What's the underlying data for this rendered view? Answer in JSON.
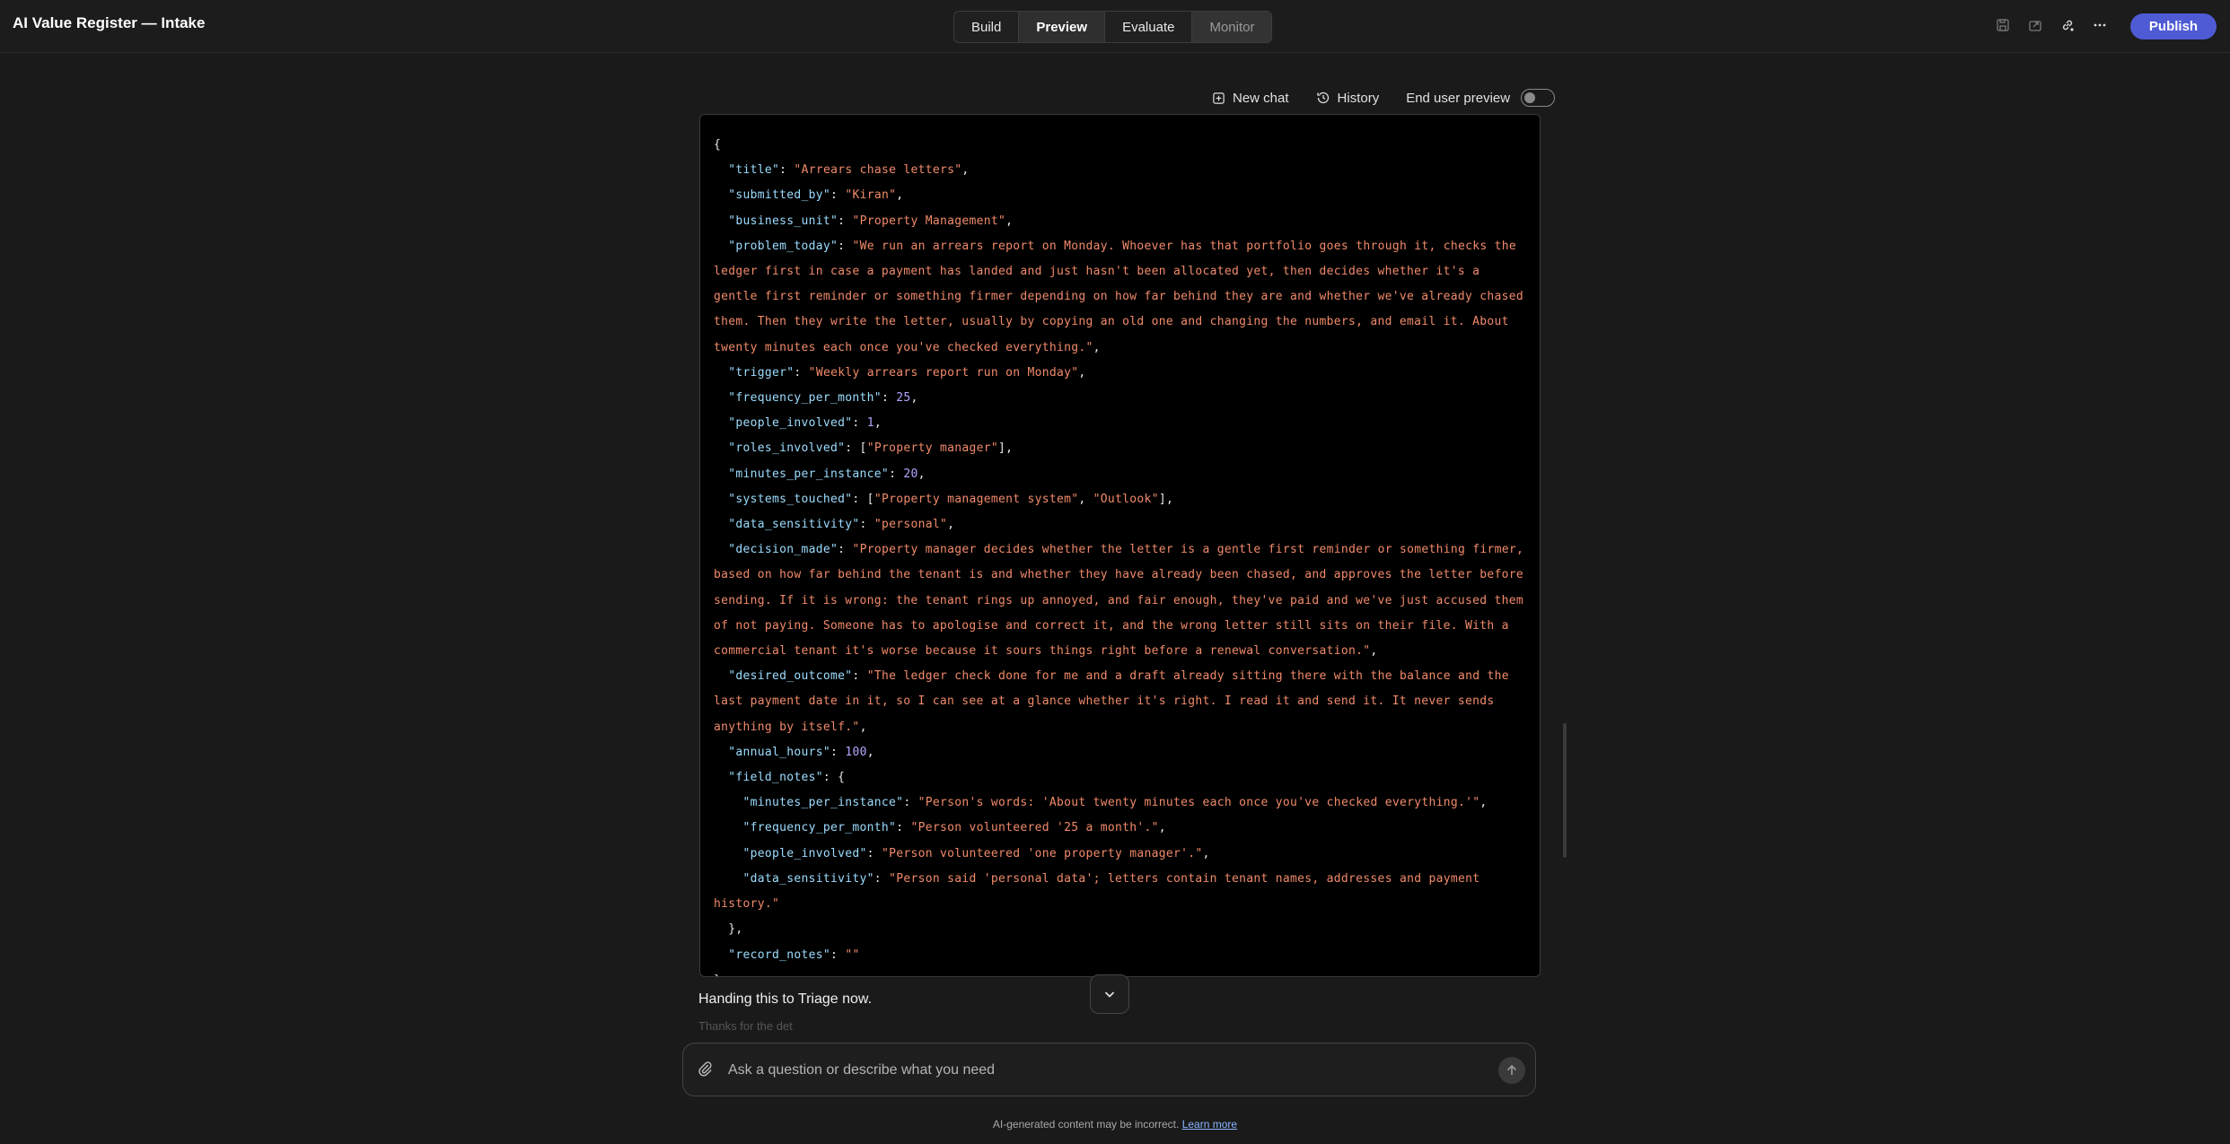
{
  "app": {
    "title": "AI Value Register — Intake"
  },
  "tabs": [
    "Build",
    "Preview",
    "Evaluate",
    "Monitor"
  ],
  "topbar": {
    "icons": [
      "save-icon",
      "share-icon",
      "link-icon",
      "more-icon"
    ],
    "publish_label": "Publish",
    "accent_color": "#4f5bd5"
  },
  "chat_toolbar": {
    "new_chat": "New chat",
    "history": "History",
    "end_user_preview": "End user preview",
    "end_user_preview_on": false
  },
  "record": {
    "title": "Arrears chase letters",
    "submitted_by": "Kiran",
    "business_unit": "Property Management",
    "problem_today": "We run an arrears report on Monday. Whoever has that portfolio goes through it, checks the ledger first in case a payment has landed and just hasn't been allocated yet, then decides whether it's a gentle first reminder or something firmer depending on how far behind they are and whether we've already chased them. Then they write the letter, usually by copying an old one and changing the numbers, and email it. About twenty minutes each once you've checked everything.",
    "trigger": "Weekly arrears report run on Monday",
    "frequency_per_month": 25,
    "people_involved": 1,
    "roles_involved": [
      "Property manager"
    ],
    "minutes_per_instance": 20,
    "systems_touched": [
      "Property management system",
      "Outlook"
    ],
    "data_sensitivity": "personal",
    "decision_made": "Property manager decides whether the letter is a gentle first reminder or something firmer, based on how far behind the tenant is and whether they have already been chased, and approves the letter before sending. If it is wrong: the tenant rings up annoyed, and fair enough, they've paid and we've just accused them of not paying. Someone has to apologise and correct it, and the wrong letter still sits on their file. With a commercial tenant it's worse because it sours things right before a renewal conversation.",
    "desired_outcome": "The ledger check done for me and a draft already sitting there with the balance and the last payment date in it, so I can see at a glance whether it's right. I read it and send it. It never sends anything by itself.",
    "annual_hours": 100,
    "field_notes": {
      "minutes_per_instance": "Person's words: 'About twenty minutes each once you've checked everything.'",
      "frequency_per_month": "Person volunteered '25 a month'.",
      "people_involved": "Person volunteered 'one property manager'.",
      "data_sensitivity": "Person said 'personal data'; letters contain tenant names, addresses and payment history."
    },
    "record_notes": ""
  },
  "handoff_text": "Handing this to Triage now.",
  "faded_text": "Thanks for the det",
  "composer": {
    "placeholder": "Ask a question or describe what you need"
  },
  "disclaimer": {
    "text": "AI-generated content may be incorrect.",
    "link": "Learn more"
  }
}
